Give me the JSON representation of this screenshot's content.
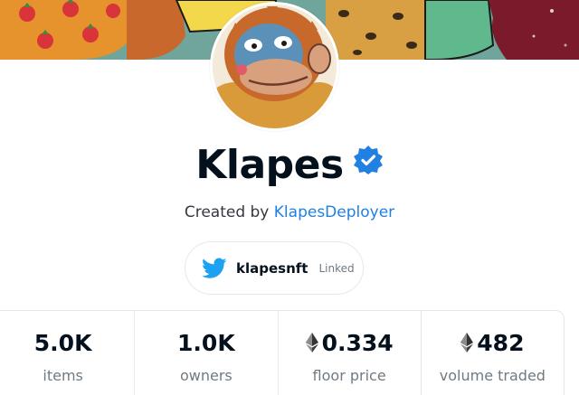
{
  "collection": {
    "title": "Klapes",
    "verified": true,
    "creator_prefix": "Created by",
    "creator_name": "KlapesDeployer"
  },
  "twitter": {
    "icon": "twitter-icon",
    "handle": "klapesnft",
    "status": "Linked"
  },
  "stats": [
    {
      "value": "5.0K",
      "label": "items",
      "currency_icon": ""
    },
    {
      "value": "1.0K",
      "label": "owners",
      "currency_icon": ""
    },
    {
      "value": "0.334",
      "label": "floor price",
      "currency_icon": "ethereum-icon"
    },
    {
      "value": "482",
      "label": "volume traded",
      "currency_icon": "ethereum-icon"
    }
  ],
  "colors": {
    "accent": "#2081e2",
    "text": "#04111d",
    "muted": "#707a83",
    "border": "#e5e8eb",
    "twitter_blue": "#1da1f2"
  }
}
